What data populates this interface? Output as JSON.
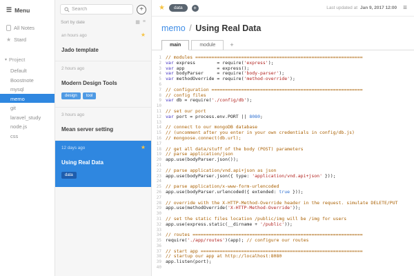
{
  "icons": {
    "menu": "☰",
    "hamburger": "≡",
    "star": "★",
    "plus": "+",
    "grid": "▦",
    "list": "≡",
    "caret": "▾"
  },
  "sidebar": {
    "menu_label": "Menu",
    "all_notes_label": "All Notes",
    "starred_label": "Stard",
    "section_label": "Project",
    "items": [
      "Default",
      "Boostnote",
      "mysql",
      "memo",
      "git",
      "laravel_study",
      "node.js",
      "css"
    ],
    "selected": "memo"
  },
  "notelist": {
    "search_placeholder": "Search",
    "sort_label": "Sort by date",
    "notes": [
      {
        "time": "an hours ago",
        "title": "Jado template",
        "starred": true,
        "tags": [],
        "selected": false
      },
      {
        "time": "2 hours ago",
        "title": "Modern Design Tools",
        "starred": false,
        "tags": [
          "design",
          "tool"
        ],
        "selected": false
      },
      {
        "time": "3 hours ago",
        "title": "Mean server setting",
        "starred": false,
        "tags": [],
        "selected": false
      },
      {
        "time": "12 days ago",
        "title": "Using Real Data",
        "starred": true,
        "tags": [
          "data"
        ],
        "selected": true
      }
    ]
  },
  "editor": {
    "toolbar": {
      "tag": "data",
      "updated_label": "Last updated at",
      "updated_value": "Jan 9, 2017 12:00"
    },
    "breadcrumb": {
      "folder": "memo",
      "separator": "/",
      "title": "Using Real Data"
    },
    "tabs": [
      "main",
      "module"
    ],
    "active_tab": "main",
    "new_tab_label": "+",
    "code_lines": [
      "// modules ==============================================================",
      "var express        = require('express');",
      "var app            = express();",
      "var bodyParser     = require('body-parser');",
      "var methodOverride = require('method-override');",
      "",
      "// configuration ========================================================",
      "// config files",
      "var db = require('./config/db');",
      "",
      "// set our port",
      "var port = process.env.PORT || 8080;",
      "",
      "// connect to our mongoDB database",
      "// (uncomment after you enter in your own credentials in config/db.js)",
      "// mongoose.connect(db.url);",
      "",
      "// get all data/stuff of the body (POST) parameters",
      "// parse application/json",
      "app.use(bodyParser.json());",
      "",
      "// parse application/vnd.api+json as json",
      "app.use(bodyParser.json({ type: 'application/vnd.api+json' }));",
      "",
      "// parse application/x-www-form-urlencoded",
      "app.use(bodyParser.urlencoded({ extended: true }));",
      "",
      "// override with the X-HTTP-Method-Override header in the request. simulate DELETE/PUT",
      "app.use(methodOverride('X-HTTP-Method-Override'));",
      "",
      "// set the static files location /public/img will be /img for users",
      "app.use(express.static(__dirname + '/public'));",
      "",
      "// routes ===============================================================",
      "require('./app/routes')(app); // configure our routes",
      "",
      "// start app ============================================================",
      "// startup our app at http://localhost:8080",
      "app.listen(port);",
      ""
    ]
  },
  "colors": {
    "accent_blue": "#2f87e0",
    "star_yellow": "#f6c344",
    "tag_blue": "#4f9ae4",
    "selected_tag_blue": "#1e5dad",
    "toolbar_pill": "#5a6570",
    "comment": "#a95f00",
    "string": "#b1201c",
    "keyword": "#3d2bbf",
    "number": "#2d6fd0"
  }
}
